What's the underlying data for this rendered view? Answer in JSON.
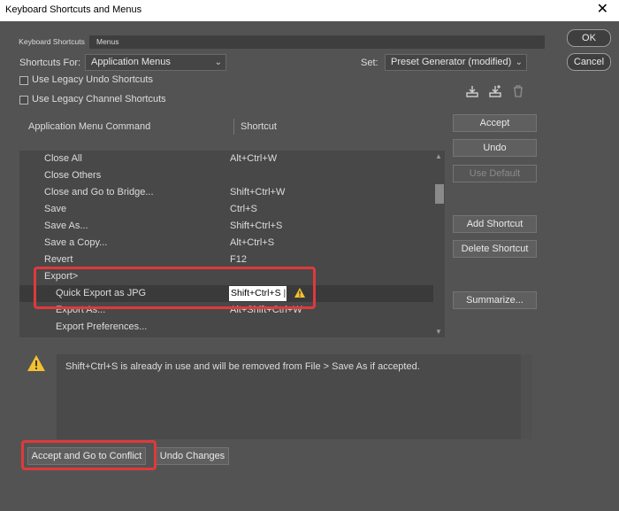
{
  "window": {
    "title": "Keyboard Shortcuts and Menus",
    "close_glyph": "✕"
  },
  "tabs": [
    {
      "label": "Keyboard Shortcuts"
    },
    {
      "label": "Menus"
    }
  ],
  "shortcuts_for": {
    "label": "Shortcuts For:",
    "value": "Application Menus"
  },
  "set": {
    "label": "Set:",
    "value": "Preset Generator (modified)"
  },
  "checkboxes": [
    {
      "label": "Use Legacy Undo Shortcuts",
      "checked": false
    },
    {
      "label": "Use Legacy Channel Shortcuts",
      "checked": false
    }
  ],
  "table": {
    "col_command": "Application Menu Command",
    "col_shortcut": "Shortcut",
    "rows": [
      {
        "command": "Close All",
        "shortcut": "Alt+Ctrl+W"
      },
      {
        "command": "Close Others",
        "shortcut": ""
      },
      {
        "command": "Close and Go to Bridge...",
        "shortcut": "Shift+Ctrl+W"
      },
      {
        "command": "Save",
        "shortcut": "Ctrl+S"
      },
      {
        "command": "Save As...",
        "shortcut": "Shift+Ctrl+S"
      },
      {
        "command": "Save a Copy...",
        "shortcut": "Alt+Ctrl+S"
      },
      {
        "command": "Revert",
        "shortcut": "F12"
      },
      {
        "command": "Export>",
        "shortcut": ""
      },
      {
        "command": "Quick Export as JPG",
        "shortcut": "Shift+Ctrl+S",
        "selected": true
      },
      {
        "command": "Export As...",
        "shortcut": "Alt+Shift+Ctrl+W"
      },
      {
        "command": "Export Preferences...",
        "shortcut": ""
      }
    ]
  },
  "buttons": {
    "ok": "OK",
    "cancel": "Cancel",
    "accept": "Accept",
    "undo": "Undo",
    "use_default": "Use Default",
    "add_shortcut": "Add Shortcut",
    "delete_shortcut": "Delete Shortcut",
    "summarize": "Summarize...",
    "accept_goto_conflict": "Accept and Go to Conflict",
    "undo_changes": "Undo Changes"
  },
  "message": "Shift+Ctrl+S is already in use and will be removed from File > Save As if accepted.",
  "colors": {
    "highlight": "#e0393b",
    "warning": "#f2c12e",
    "background": "#535353"
  }
}
